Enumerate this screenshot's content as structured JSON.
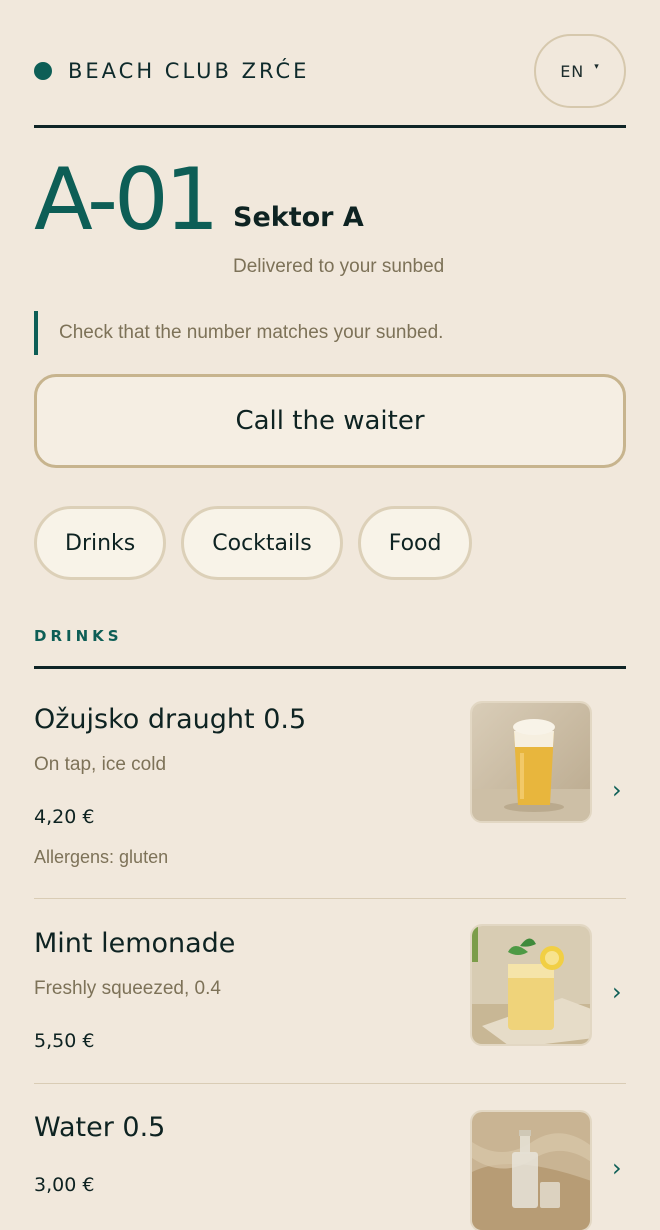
{
  "header": {
    "brand": "BEACH CLUB ZRĆE",
    "language": "EN",
    "colors": {
      "accent": "#0d5e56",
      "background": "#f1e8dc"
    }
  },
  "table": {
    "id": "A-01",
    "sector": "Sektor A",
    "delivery": "Delivered to your sunbed",
    "notice": "Check that the number matches your sunbed."
  },
  "actions": {
    "call_waiter": "Call the waiter"
  },
  "categories": [
    "Drinks",
    "Cocktails",
    "Food"
  ],
  "section": {
    "title": "DRINKS"
  },
  "items": [
    {
      "name": "Ožujsko draught 0.5",
      "description": "On tap, ice cold",
      "price": "4,20 €",
      "allergens": "Allergens: gluten",
      "image": "beer-glass"
    },
    {
      "name": "Mint lemonade",
      "description": "Freshly squeezed, 0.4",
      "price": "5,50 €",
      "image": "lemonade-glass"
    },
    {
      "name": "Water 0.5",
      "price": "3,00 €",
      "image": "water-bottle"
    }
  ]
}
